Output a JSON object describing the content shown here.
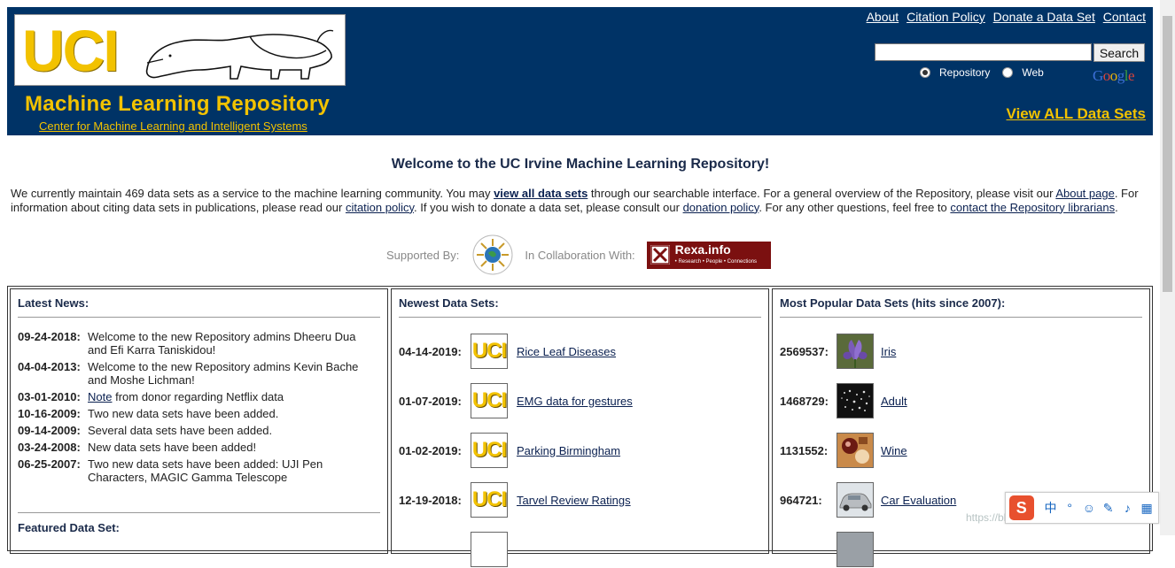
{
  "header": {
    "logo_text": "UCI",
    "title": "Machine Learning Repository",
    "subtitle": "Center for Machine Learning and Intelligent Systems",
    "nav": [
      "About",
      "Citation Policy",
      "Donate a Data Set",
      "Contact"
    ],
    "search_button": "Search",
    "search_value": "",
    "radio_options": [
      {
        "label": "Repository",
        "checked": true
      },
      {
        "label": "Web",
        "checked": false
      }
    ],
    "google_logo": "Google",
    "view_all": "View ALL Data Sets"
  },
  "welcome": {
    "title": "Welcome to the UC Irvine Machine Learning Repository!",
    "intro_parts": {
      "p1": "We currently maintain 469 data sets as a service to the machine learning community. You may ",
      "link_view_all": "view all data sets",
      "p2": " through our searchable interface. For a general overview of the Repository, please visit our ",
      "link_about": "About page",
      "p3": ". For information about citing data sets in publications, please read our ",
      "link_citation": "citation policy",
      "p4": ". If you wish to donate a data set, please consult our ",
      "link_donation": "donation policy",
      "p5": ". For any other questions, feel free to ",
      "link_contact": "contact the Repository librarians",
      "p6": "."
    },
    "supported_by": "Supported By:",
    "collaboration": "In Collaboration With:",
    "rexa_name": "Rexa.info",
    "rexa_tagline": "• Research • People • Connections"
  },
  "news": {
    "heading": "Latest News:",
    "items": [
      {
        "date": "09-24-2018:",
        "text": "Welcome to the new Repository admins Dheeru Dua and Efi Karra Taniskidou!"
      },
      {
        "date": "04-04-2013:",
        "text": "Welcome to the new Repository admins Kevin Bache and Moshe Lichman!"
      },
      {
        "date": "03-01-2010:",
        "link": "Note",
        "text": " from donor regarding Netflix data"
      },
      {
        "date": "10-16-2009:",
        "text": "Two new data sets have been added."
      },
      {
        "date": "09-14-2009:",
        "text": "Several data sets have been added."
      },
      {
        "date": "03-24-2008:",
        "text": "New data sets have been added!"
      },
      {
        "date": "06-25-2007:",
        "text": "Two new data sets have been added: UJI Pen Characters, MAGIC Gamma Telescope"
      }
    ],
    "featured_heading": "Featured Data Set:"
  },
  "newest": {
    "heading": "Newest Data Sets:",
    "thumb_text": "UCI",
    "items": [
      {
        "date": "04-14-2019:",
        "name": "Rice Leaf Diseases"
      },
      {
        "date": "01-07-2019:",
        "name": "EMG data for gestures"
      },
      {
        "date": "01-02-2019:",
        "name": "Parking Birmingham"
      },
      {
        "date": "12-19-2018:",
        "name": "Tarvel Review Ratings"
      }
    ]
  },
  "popular": {
    "heading": "Most Popular Data Sets (hits since 2007):",
    "items": [
      {
        "count": "2569537:",
        "name": "Iris"
      },
      {
        "count": "1468729:",
        "name": "Adult"
      },
      {
        "count": "1131552:",
        "name": "Wine"
      },
      {
        "count": "964721:",
        "name": "Car Evaluation"
      }
    ]
  },
  "ime": {
    "s_label": "S",
    "chinese_label": "中"
  },
  "watermark": "https://blog.csdn.net/weixin_45287708",
  "colors": {
    "header_bg": "#003366",
    "gold": "#f2c200",
    "rexa_red": "#7b1010"
  }
}
